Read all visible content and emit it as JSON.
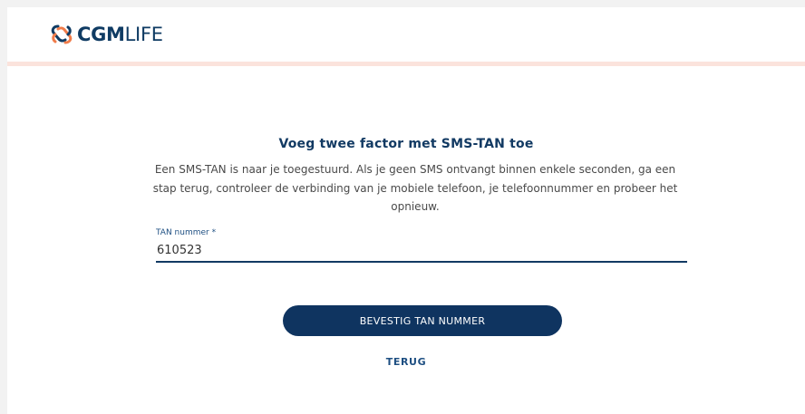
{
  "header": {
    "logo": {
      "icon": "cgm-knot-logo-icon",
      "text_bold": "CGM",
      "text_light": "LIFE",
      "color": "#0f3b63",
      "accent_color": "#f07c4a"
    },
    "divider_color": "#fbe3dc"
  },
  "form": {
    "title": "Voeg twee factor met SMS-TAN toe",
    "description": "Een SMS-TAN is naar je toegestuurd. Als je geen SMS ontvangt binnen enkele seconden, ga een stap terug, controleer de verbinding van je mobiele telefoon, je telefoonnummer en probeer het opnieuw.",
    "tan_field": {
      "label": "TAN nummer *",
      "value": "610523"
    },
    "confirm_button": "BEVESTIG TAN NUMMER",
    "back_link": "TERUG"
  },
  "colors": {
    "primary": "#0f3460",
    "title": "#123a63",
    "text": "#4a4a4a"
  }
}
